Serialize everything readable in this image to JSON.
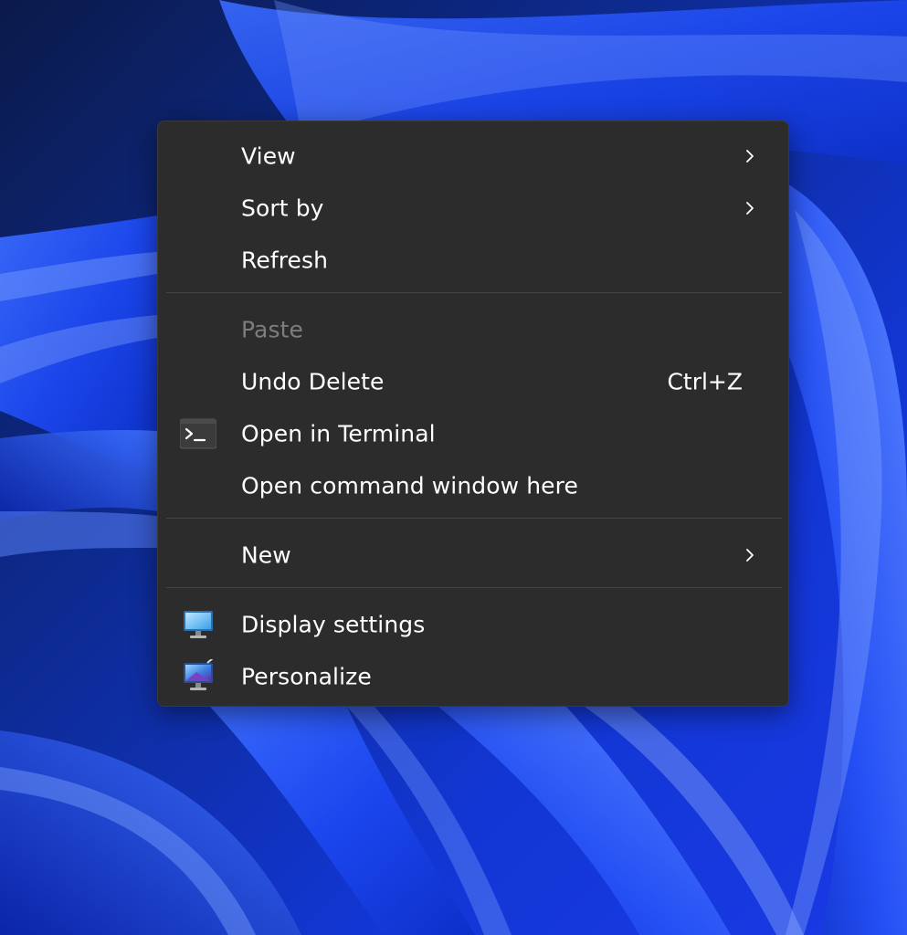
{
  "context_menu": {
    "view_label": "View",
    "sort_by_label": "Sort by",
    "refresh_label": "Refresh",
    "paste_label": "Paste",
    "undo_delete_label": "Undo Delete",
    "undo_delete_shortcut": "Ctrl+Z",
    "open_terminal_label": "Open in Terminal",
    "open_command_window_label": "Open command window here",
    "new_label": "New",
    "display_settings_label": "Display settings",
    "personalize_label": "Personalize"
  },
  "icons": {
    "view_submenu": "chevron-right-icon",
    "sort_by_submenu": "chevron-right-icon",
    "new_submenu": "chevron-right-icon",
    "open_terminal": "terminal-icon",
    "display_settings": "monitor-icon",
    "personalize": "personalize-icon"
  },
  "colors": {
    "menu_background": "#2c2c2c",
    "menu_text": "#ffffff",
    "disabled_text": "#7d7d7d",
    "separator": "#444444",
    "wallpaper_base": "#0a2dd6"
  }
}
